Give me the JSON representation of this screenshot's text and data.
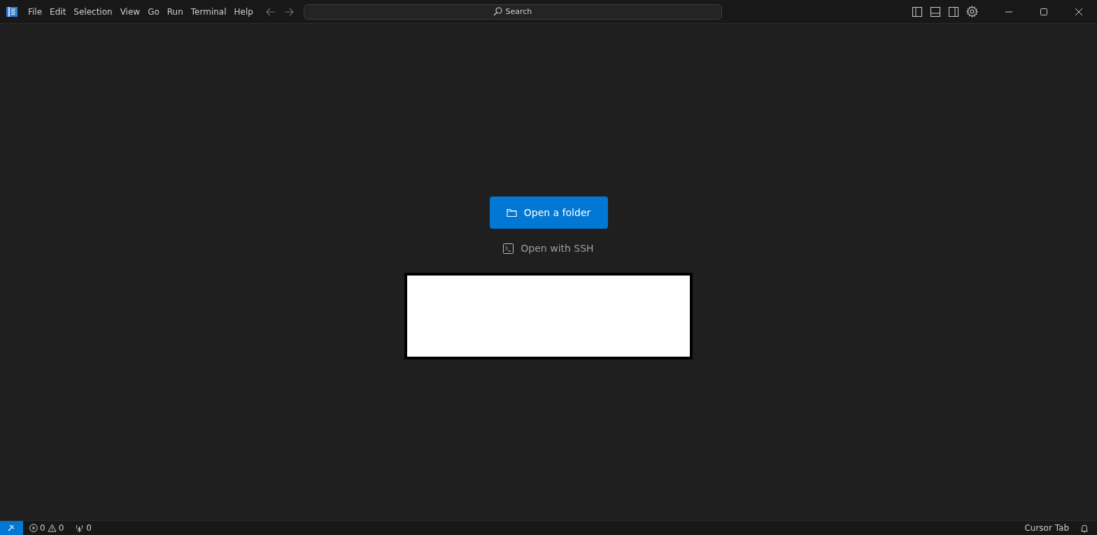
{
  "menu": [
    "File",
    "Edit",
    "Selection",
    "View",
    "Go",
    "Run",
    "Terminal",
    "Help"
  ],
  "search": {
    "placeholder": "Search"
  },
  "actions": [
    {
      "kind": "primary",
      "label": "Open a folder"
    },
    {
      "kind": "link",
      "label": "Open with SSH"
    }
  ],
  "status_bar": {
    "errors": "0",
    "warnings": "0",
    "ports": "0",
    "right_label": "Cursor Tab"
  }
}
